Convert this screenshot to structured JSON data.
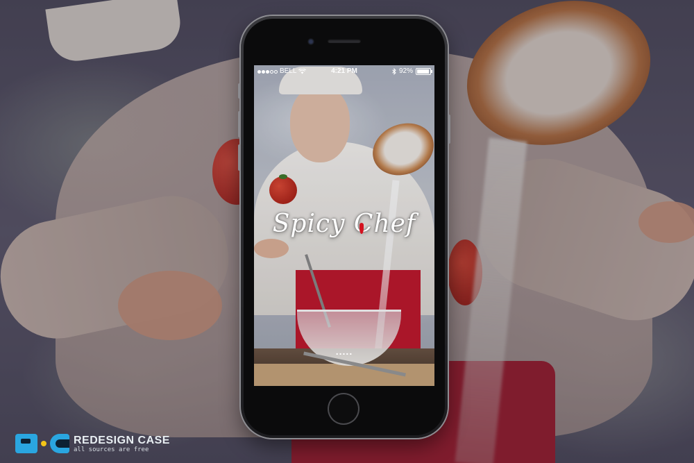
{
  "status_bar": {
    "carrier": "BELL",
    "time": "4:21 PM",
    "battery_percent": "92%",
    "battery_level": 0.92,
    "signal_bars_filled": 3,
    "signal_bars_total": 5,
    "icons": [
      "signal-dots-icon",
      "wifi-icon",
      "bluetooth-icon",
      "battery-icon"
    ]
  },
  "app": {
    "logo_text": "Spicy Chef",
    "loading_indicator": "....."
  },
  "watermark": {
    "title": "REDESIGN CASE",
    "subtitle": "all sources are free"
  },
  "colors": {
    "apron_red": "#c0172c",
    "watermark_blue": "#2aa6e0",
    "watermark_yellow": "#f4c518",
    "phone_body": "#1c1c1f"
  }
}
